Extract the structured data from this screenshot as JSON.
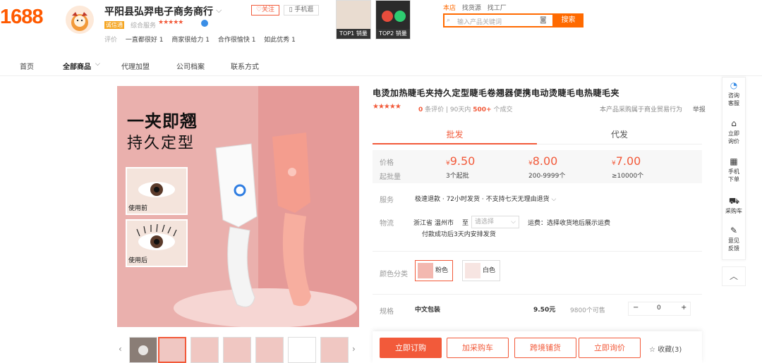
{
  "header": {
    "logo": "1688",
    "shop_name": "平阳县弘羿电子商务商行",
    "follow_label": "♡关注",
    "mobile_label": "▯ 手机逛",
    "badge": "诚信通",
    "service_label": "综合服务",
    "service_stars": "★★★★★",
    "eval_label": "评价",
    "eval_items": [
      "一直都很好 1",
      "商家很给力 1",
      "合作很愉快 1",
      "如此优秀 1"
    ],
    "top_thumbs": [
      {
        "label": "TOP1 销量"
      },
      {
        "label": "TOP2 销量"
      }
    ],
    "top_links": [
      "本店",
      "找货源",
      "找工厂"
    ],
    "search_placeholder": "输入产品关键词",
    "search_button": "搜索"
  },
  "nav": {
    "items": [
      "首页",
      "全部商品",
      "代理加盟",
      "公司档案",
      "联系方式"
    ],
    "active_index": 1
  },
  "gallery": {
    "slogan_line1": "一夹即翘",
    "slogan_line2": "持久定型",
    "before_label": "使用前",
    "after_label": "使用后",
    "thumb_count": 7
  },
  "product": {
    "title": "电烫加热睫毛夹持久定型睫毛卷翘器便携电动烫睫毛电热睫毛夹",
    "rating_stars": "★★★★★",
    "review_count": "0",
    "review_label": "条评价",
    "sold_period": "90天内",
    "sold_count": "500+",
    "sold_label": "个成交",
    "purchase_note": "本产品采购属于商业贸易行为",
    "report_label": "举报",
    "tab_wholesale": "批发",
    "tab_dropship": "代发",
    "price_label": "价格",
    "qty_label": "起批量",
    "price_tiers": [
      {
        "currency": "¥",
        "price": "9.50",
        "qty": "3个起批"
      },
      {
        "currency": "¥",
        "price": "8.00",
        "qty": "200-9999个"
      },
      {
        "currency": "¥",
        "price": "7.00",
        "qty": "≥10000个"
      }
    ],
    "service_label": "服务",
    "service_text": "极速退款 · 72小时发货 · 不支持七天无理由退货",
    "logistics_label": "物流",
    "origin": "浙江省 温州市",
    "to_label": "至",
    "dest_placeholder": "请选择",
    "shipping_fee": "运费：选择收货地后展示运费",
    "ship_time": "付款成功后3天内安排发货",
    "color_label": "颜色分类",
    "colors": [
      "粉色",
      "白色"
    ],
    "spec_label": "规格",
    "spec_name": "中文包装",
    "spec_price": "9.50元",
    "spec_stock": "9800个可售",
    "spec_qty": "0",
    "minus": "−",
    "plus": "+"
  },
  "actions": {
    "buy_now": "立即订购",
    "add_cart": "加采购车",
    "cross_border": "跨境铺货",
    "inquire": "立即询价",
    "favorite": "☆ 收藏(3)"
  },
  "toolbar": {
    "items": [
      {
        "icon": "chat-icon",
        "label": "咨询\n客服"
      },
      {
        "icon": "house-icon",
        "label": "立即\n询价"
      },
      {
        "icon": "qr-icon",
        "label": "手机\n下单"
      },
      {
        "icon": "cart-icon",
        "label": "采购车"
      },
      {
        "icon": "edit-icon",
        "label": "意见\n反馈"
      }
    ],
    "top_icon": "chevron-up-icon"
  }
}
